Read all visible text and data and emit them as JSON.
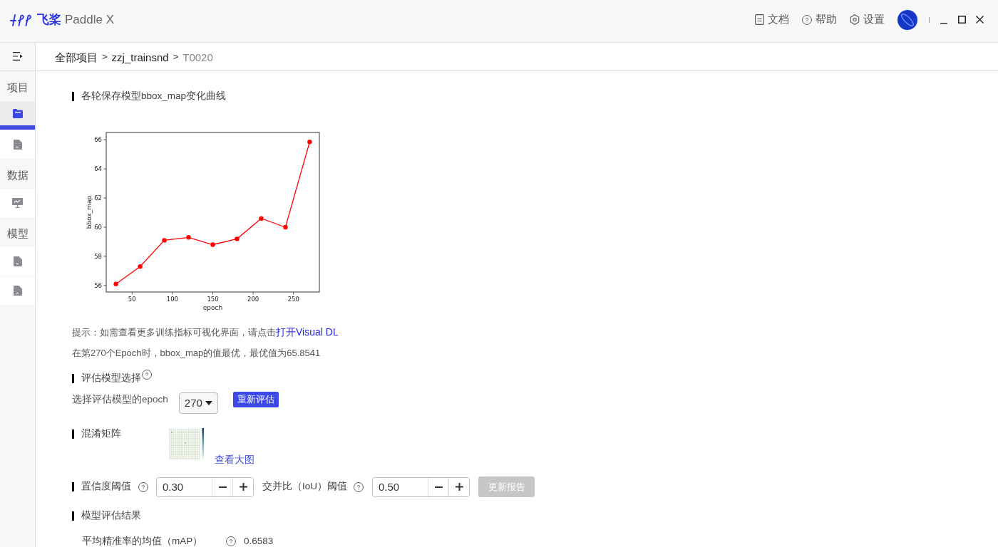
{
  "header": {
    "logo": {
      "brand": "飞桨",
      "product": "Paddle X"
    },
    "links": [
      {
        "kind": "doc",
        "label": "文档"
      },
      {
        "kind": "help",
        "label": "帮助"
      },
      {
        "kind": "settings",
        "label": "设置"
      }
    ]
  },
  "breadcrumb": {
    "separator": ">",
    "items": [
      {
        "label": "全部项目",
        "current": false
      },
      {
        "label": "zzj_trainsnd",
        "current": false
      },
      {
        "label": "T0020",
        "current": true
      }
    ]
  },
  "sidebar": {
    "sections": [
      {
        "label": "项目",
        "items": [
          {
            "kind": "folder",
            "selected": true
          },
          {
            "kind": "file",
            "selected": false
          }
        ]
      },
      {
        "label": "数据",
        "items": [
          {
            "kind": "chart",
            "selected": false
          }
        ]
      },
      {
        "label": "模型",
        "items": [
          {
            "kind": "file",
            "selected": false
          },
          {
            "kind": "file",
            "selected": false
          }
        ]
      }
    ]
  },
  "curve": {
    "title": "各轮保存模型bbox_map变化曲线",
    "chart_data": {
      "type": "line",
      "xlabel": "epoch",
      "ylabel": "bbox_map",
      "x": [
        30,
        60,
        90,
        120,
        150,
        180,
        210,
        240,
        270
      ],
      "values": [
        56.1,
        57.3,
        59.1,
        59.3,
        58.8,
        59.2,
        60.6,
        60.0,
        65.85
      ],
      "color": "#ff0000",
      "marker": "o",
      "xlim": [
        18,
        282
      ],
      "ylim": [
        55.55,
        66.5
      ],
      "xticks": [
        50,
        100,
        150,
        200,
        250
      ],
      "yticks": [
        56,
        58,
        60,
        62,
        64,
        66
      ]
    }
  },
  "hint": {
    "text": "提示：如需查看更多训练指标可视化界面，请点击",
    "link": "打开Visual DL"
  },
  "best_note": "在第270个Epoch时，bbox_map的值最优，最优值为65.8541",
  "eval_select": {
    "title": "评估模型选择",
    "label": "选择评估模型的epoch",
    "epoch": "270",
    "button": "重新评估"
  },
  "confusion_matrix": {
    "title": "混淆矩阵",
    "link": "查看大图"
  },
  "thresholds": {
    "title": "置信度阈值",
    "confidence": "0.30",
    "iou_label": "交并比（IoU）阈值",
    "iou": "0.50",
    "update_button": {
      "label": "更新报告",
      "disabled": true
    }
  },
  "results": {
    "title": "模型评估结果",
    "metrics": [
      {
        "label": "平均精准率的均值（mAP）",
        "value": "0.6583"
      }
    ]
  }
}
